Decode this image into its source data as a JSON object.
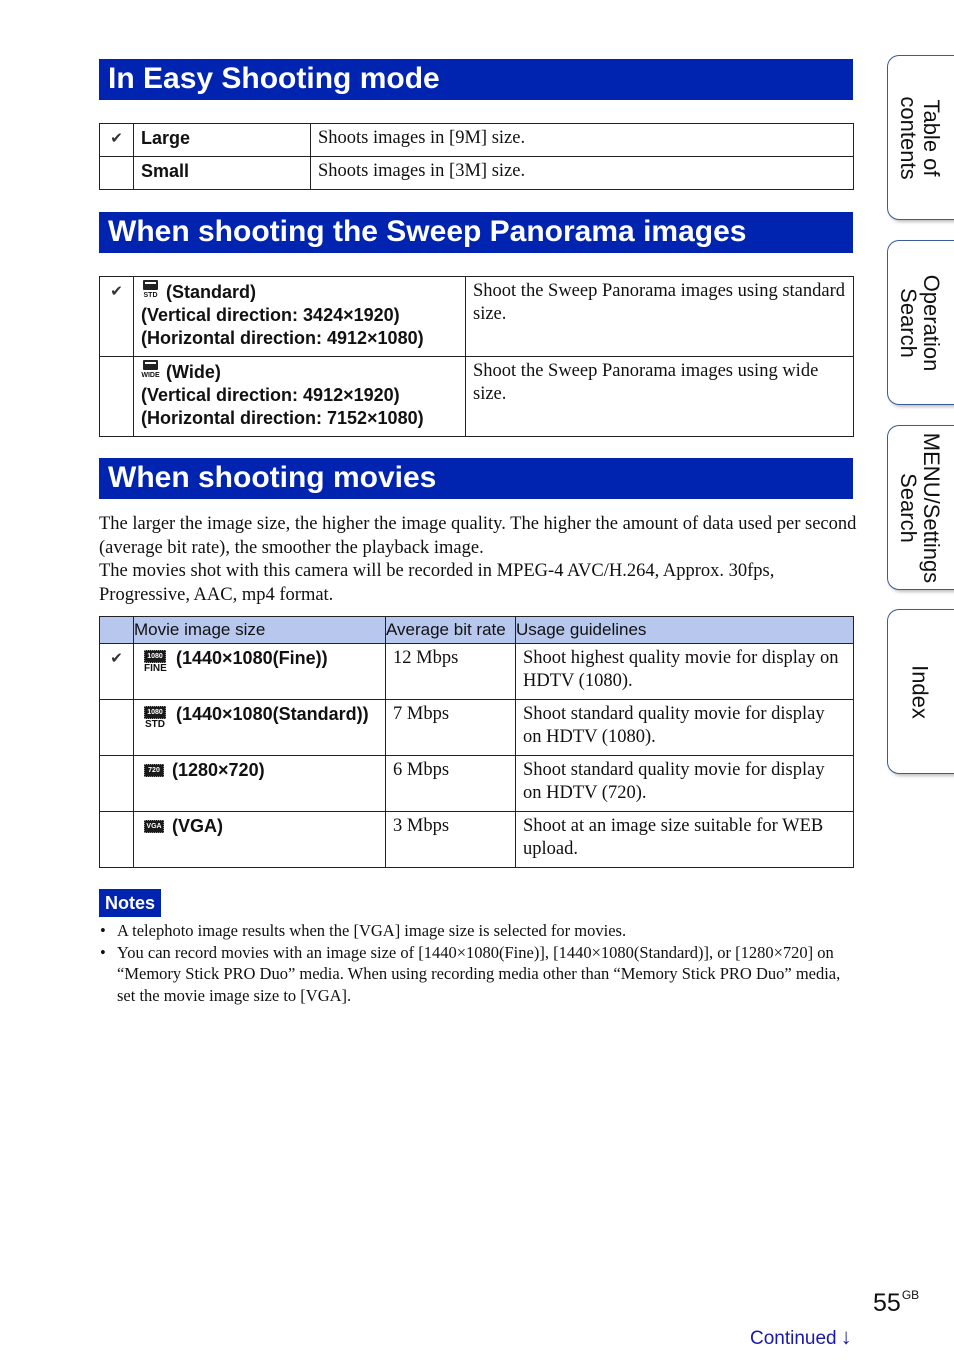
{
  "sections": {
    "easy": {
      "title": "In Easy Shooting mode"
    },
    "panorama": {
      "title": "When shooting the Sweep Panorama images"
    },
    "movies": {
      "title": "When shooting movies"
    }
  },
  "easy_table": {
    "rows": [
      {
        "checked": true,
        "label": "Large",
        "desc": "Shoots images in [9M] size."
      },
      {
        "checked": false,
        "label": "Small",
        "desc": "Shoots images in [3M] size."
      }
    ]
  },
  "panorama_table": {
    "rows": [
      {
        "checked": true,
        "icon": "panorama-standard-icon",
        "icon_label": "STD",
        "name": "(Standard)",
        "vertical": "(Vertical direction: 3424×1920)",
        "horizontal": "(Horizontal direction: 4912×1080)",
        "desc": "Shoot the Sweep Panorama images using standard size."
      },
      {
        "checked": false,
        "icon": "panorama-wide-icon",
        "icon_label": "WIDE",
        "name": "(Wide)",
        "vertical": "(Vertical direction: 4912×1920)",
        "horizontal": "(Horizontal direction: 7152×1080)",
        "desc": "Shoot the Sweep Panorama images using wide size."
      }
    ]
  },
  "movies_intro": {
    "p1": "The larger the image size, the higher the image quality. The higher the amount of data used per second (average bit rate), the smoother the playback image.",
    "p2": "The movies shot with this camera will be recorded in MPEG-4 AVC/H.264, Approx. 30fps, Progressive, AAC, mp4 format."
  },
  "movie_table": {
    "headers": [
      "Movie image size",
      "Average bit rate",
      "Usage guidelines"
    ],
    "rows": [
      {
        "checked": true,
        "icon": "movie-1080-fine-icon",
        "chip": "1080",
        "sub": "FINE",
        "size": "(1440×1080(Fine))",
        "bitrate": "12 Mbps",
        "usage": "Shoot highest quality movie for display on HDTV (1080)."
      },
      {
        "checked": false,
        "icon": "movie-1080-std-icon",
        "chip": "1080",
        "sub": "STD",
        "size": "(1440×1080(Standard))",
        "bitrate": "7 Mbps",
        "usage": "Shoot standard quality movie for display on HDTV (1080)."
      },
      {
        "checked": false,
        "icon": "movie-720-icon",
        "chip": "720",
        "sub": "",
        "size": "(1280×720)",
        "bitrate": "6 Mbps",
        "usage": "Shoot standard quality movie for display on HDTV (720)."
      },
      {
        "checked": false,
        "icon": "movie-vga-icon",
        "chip": "VGA",
        "sub": "",
        "size": "(VGA)",
        "bitrate": "3 Mbps",
        "usage": "Shoot at an image size suitable for WEB upload."
      }
    ]
  },
  "notes": {
    "title": "Notes",
    "items": [
      "A telephoto image results when the [VGA] image size is selected for movies.",
      "You can record movies with an image size of [1440×1080(Fine)], [1440×1080(Standard)], or [1280×720] on “Memory Stick PRO Duo” media. When using recording media other than “Memory Stick PRO Duo” media, set the movie image size to [VGA]."
    ]
  },
  "side_tabs": [
    {
      "label": "Table of\ncontents"
    },
    {
      "label": "Operation\nSearch"
    },
    {
      "label": "MENU/Settings\nSearch"
    },
    {
      "label": "Index"
    }
  ],
  "footer": {
    "page_number": "55",
    "page_suffix": "GB",
    "continued": "Continued",
    "continued_arrow": "↓"
  },
  "glyphs": {
    "check": "✔"
  },
  "colors": {
    "brand_blue": "#0024b0",
    "table_header": "#b8c7ee",
    "link_blue": "#1a1aa8"
  }
}
